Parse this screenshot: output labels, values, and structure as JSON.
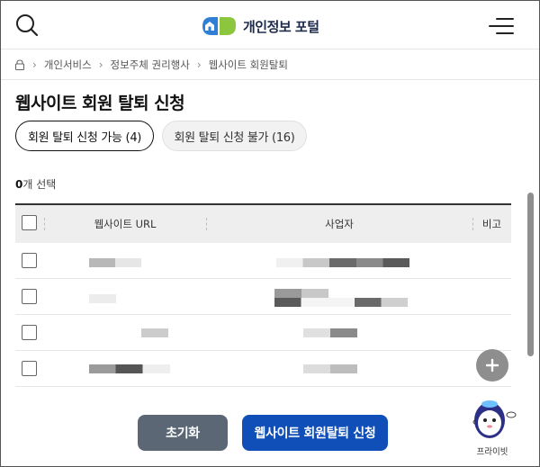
{
  "header": {
    "logo_text": "개인정보 포털",
    "search_icon": "search-icon",
    "menu_icon": "hamburger-menu-icon"
  },
  "breadcrumb": {
    "home_icon": "home-lock-icon",
    "items": [
      "개인서비스",
      "정보주체 권리행사",
      "웹사이트 회원탈퇴"
    ]
  },
  "page": {
    "title": "웹사이트 회원 탈퇴 신청"
  },
  "tabs": [
    {
      "label": "회원 탈퇴 신청 가능 (4)",
      "active": true
    },
    {
      "label": "회원 탈퇴 신청 불가 (16)",
      "active": false
    }
  ],
  "selection": {
    "count": "0",
    "suffix": "개 선택"
  },
  "table": {
    "columns": [
      "웹사이트 URL",
      "사업자",
      "비고"
    ],
    "rows": [
      {
        "url": "",
        "business": "",
        "note": ""
      },
      {
        "url": "",
        "business": "",
        "note": ""
      },
      {
        "url": "",
        "business": "",
        "note": ""
      },
      {
        "url": "",
        "business": "",
        "note": ""
      }
    ]
  },
  "buttons": {
    "reset": "초기화",
    "apply": "웹사이트 회원탈퇴 신청"
  },
  "floating": {
    "add_icon": "plus-icon",
    "mascot_label": "프라이빗"
  },
  "colors": {
    "primary": "#0f4fb7",
    "reset": "#5b6775",
    "logo_blue": "#2f7fd6",
    "logo_green": "#8cc63f"
  }
}
